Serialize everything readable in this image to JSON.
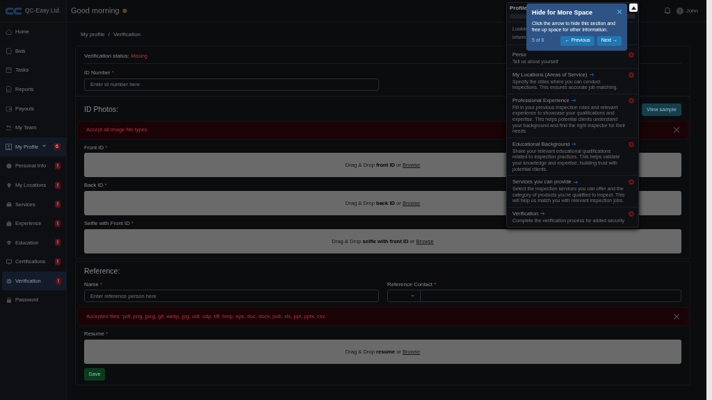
{
  "sidebar": {
    "logo_text": "QC-Easy Ltd.",
    "items": [
      {
        "label": "Home",
        "selected": false
      },
      {
        "label": "Bids",
        "selected": false
      },
      {
        "label": "Tasks",
        "selected": false
      },
      {
        "label": "Reports",
        "selected": false
      },
      {
        "label": "Payouts",
        "selected": false
      },
      {
        "label": "My Team",
        "selected": false
      },
      {
        "label": "My Profile",
        "selected": true,
        "expanded": true,
        "badge": "6",
        "children": [
          {
            "label": "Personal Info",
            "badge": "!",
            "selected": false
          },
          {
            "label": "My Locations",
            "badge": "!",
            "selected": false
          },
          {
            "label": "Services",
            "badge": "!",
            "selected": false
          },
          {
            "label": "Experience",
            "badge": "!",
            "selected": false
          },
          {
            "label": "Education",
            "badge": "!",
            "selected": false
          },
          {
            "label": "Certifications",
            "badge": "!",
            "selected": false
          },
          {
            "label": "Verification",
            "badge": "!",
            "selected": true
          },
          {
            "label": "Password",
            "selected": false
          }
        ]
      }
    ]
  },
  "topbar": {
    "greeting": "Good morning",
    "user": "John"
  },
  "breadcrumb": {
    "items": [
      "My profile",
      "Verification"
    ],
    "separator": "/"
  },
  "verification": {
    "status_label": "Verification status:",
    "status": "Missing",
    "id_number": {
      "label": "ID Number",
      "mark": "*",
      "placeholder": "Enter id number here"
    },
    "heading": "ID Photos:",
    "sample_button": "View sample",
    "alert": "Accept all image file types",
    "uploads": [
      {
        "label": "Front ID",
        "mark": "*",
        "text": "Drag & Drop **front ID** or",
        "link": "Browse"
      },
      {
        "label": "Back ID",
        "mark": "*",
        "text": "Drag & Drop **back ID** or",
        "link": "Browse"
      },
      {
        "label": "Selfie with Front ID",
        "mark": "*",
        "text": "Drag & Drop **selfie with front ID** or",
        "link": "Browse"
      }
    ]
  },
  "reference": {
    "heading": "Reference:",
    "name": {
      "label": "Name",
      "mark": "*",
      "placeholder": "Enter reference person here"
    },
    "contact": {
      "label": "Reference Contact",
      "mark": "*"
    },
    "alert": "Accepted files: 'pdf, png, jpeg, gif, webp, jpg, odt, odp, tiff, bmp, eps, doc, docx, pub, xls, ppt, pptx, csv,'",
    "resume": {
      "label": "Resume",
      "mark": "*",
      "text": "Drag & Drop **resume** or",
      "link": "Browse"
    },
    "save_button": "Save"
  },
  "profile_panel": {
    "title": "Profile",
    "intro": [
      "Lookin",
      "inform"
    ],
    "items": [
      {
        "title": "Perso",
        "text": "Tell us about yourself",
        "complete": false,
        "arrow": false
      },
      {
        "title": "My Locations (Areas of Service)",
        "text": "Specify the cities where you can conduct inspections. This ensures accurate job matching.",
        "complete": false,
        "arrow": true
      },
      {
        "title": "Professional Experience",
        "text": "Fill in your previous inspection roles and relevant experience to showcase your qualifications and expertise. This helps potential clients understand your background and find the right inspector for their needs.",
        "complete": false,
        "arrow": true
      },
      {
        "title": "Educational Background",
        "text": "Share your relevant educational qualifications related to inspection practices. This helps validate your knowledge and expertise, building trust with potential clients.",
        "complete": false,
        "arrow": true
      },
      {
        "title": "Services you can provide",
        "text": "Select the inspection services you can offer and the category of products you're qualified to inspect. This will help us match you with relevant inspection jobs.",
        "complete": false,
        "arrow": true
      },
      {
        "title": "Verification",
        "text": "Complete the verification process for added security",
        "complete": false,
        "arrow": true
      }
    ]
  },
  "tour": {
    "title": "Hide for More Space",
    "text": "Click the arrow to hide this section and free up space for other information.",
    "step": "5 of 6",
    "previous": "← Previous",
    "next": "Next →"
  }
}
